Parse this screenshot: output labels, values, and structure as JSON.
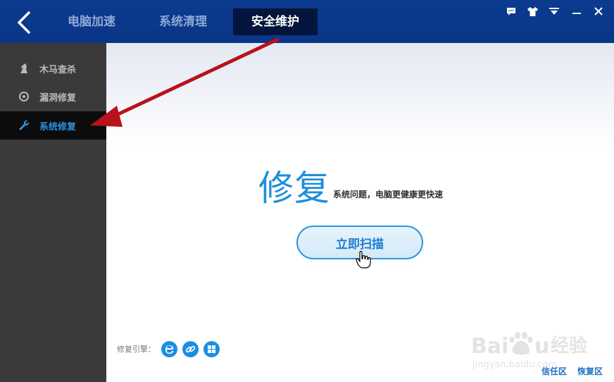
{
  "header": {
    "tabs": [
      {
        "label": "电脑加速"
      },
      {
        "label": "系统清理"
      },
      {
        "label": "安全维护"
      }
    ],
    "window_controls": [
      "chat-icon",
      "shirt-icon",
      "menu-icon",
      "minimize-icon",
      "close-icon"
    ]
  },
  "sidebar": {
    "items": [
      {
        "label": "木马查杀",
        "icon": "horse-icon"
      },
      {
        "label": "漏洞修复",
        "icon": "vulnerability-icon"
      },
      {
        "label": "系统修复",
        "icon": "wrench-icon"
      }
    ]
  },
  "main": {
    "title": "修复",
    "subtitle": "系统问题，电脑更健康更快速",
    "scan_button": "立即扫描",
    "engine_label": "修复引擎：",
    "engines": [
      "ie-icon",
      "link-icon",
      "windows-icon"
    ]
  },
  "footer": {
    "trust_zone": "信任区",
    "restore_zone": "恢复区"
  },
  "watermark": {
    "brand": "Baidu经验",
    "url": "jingyan.baidu.com"
  },
  "colors": {
    "header_bg": "#0b3a8f",
    "active_tab_bg": "#03153d",
    "sidebar_bg": "#3a3a3a",
    "accent_blue": "#1e8fdc",
    "annotation_arrow": "#c0151b"
  }
}
